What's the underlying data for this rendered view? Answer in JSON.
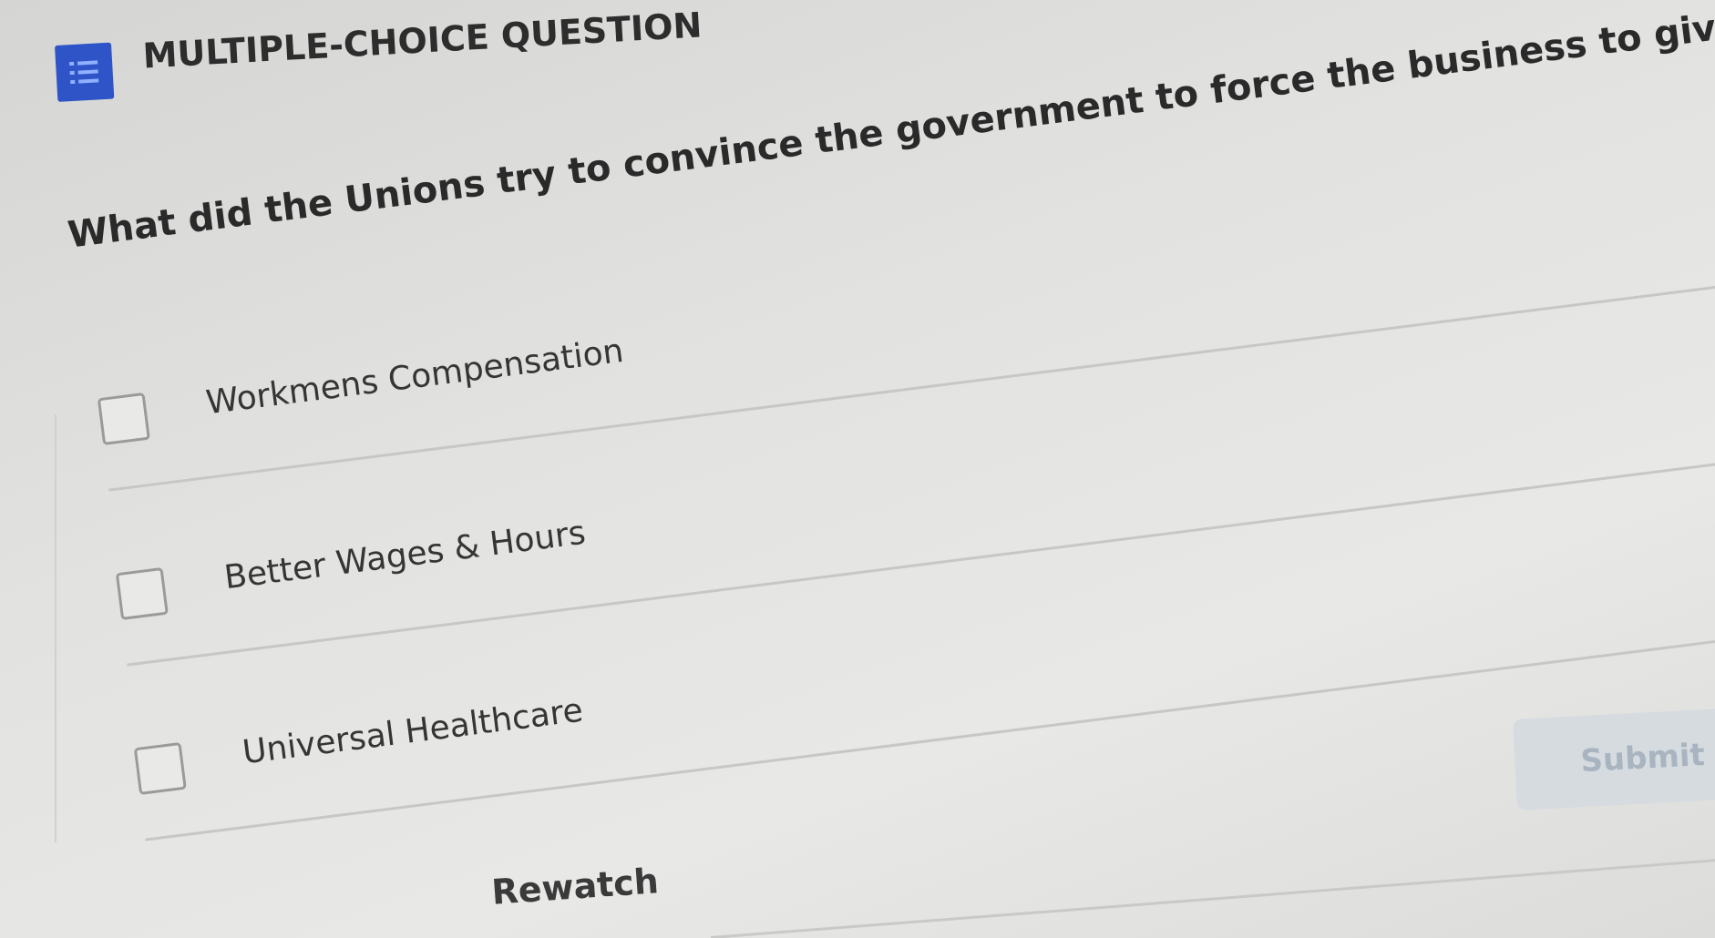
{
  "header": {
    "icon": "list-icon",
    "title": "MULTIPLE-CHOICE QUESTION",
    "badge_color": "#2f54c8"
  },
  "question": {
    "text": "What did the Unions try to convince the government to force the business to give"
  },
  "options": [
    {
      "label": "Workmens Compensation",
      "checked": false
    },
    {
      "label": "Better Wages & Hours",
      "checked": false
    },
    {
      "label": "Universal Healthcare",
      "checked": false
    }
  ],
  "actions": {
    "submit_label": "Submit",
    "rewatch_label": "Rewatch"
  }
}
